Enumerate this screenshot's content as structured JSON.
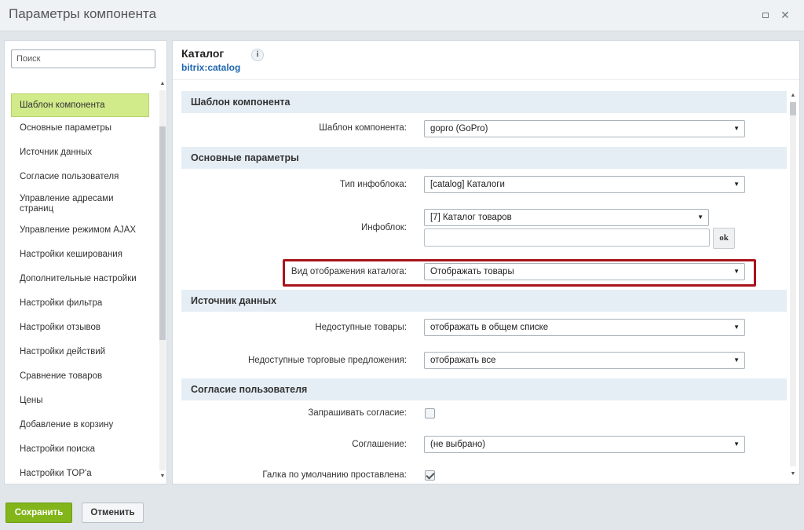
{
  "window": {
    "title": "Параметры компонента",
    "maximize_icon": "maximize-icon",
    "close_icon": "close-icon"
  },
  "sidebar": {
    "search_placeholder": "Поиск",
    "items": [
      {
        "label": "Шаблон компонента",
        "active": true
      },
      {
        "label": "Основные параметры"
      },
      {
        "label": "Источник данных"
      },
      {
        "label": "Согласие пользователя"
      },
      {
        "label": "Управление адресами страниц"
      },
      {
        "label": "Управление режимом AJAX"
      },
      {
        "label": "Настройки кеширования"
      },
      {
        "label": "Дополнительные настройки"
      },
      {
        "label": "Настройки фильтра"
      },
      {
        "label": "Настройки отзывов"
      },
      {
        "label": "Настройки действий"
      },
      {
        "label": "Сравнение товаров"
      },
      {
        "label": "Цены"
      },
      {
        "label": "Добавление в корзину"
      },
      {
        "label": "Настройки поиска"
      },
      {
        "label": "Настройки TOP'а"
      }
    ]
  },
  "component": {
    "title": "Каталог",
    "code": "bitrix:catalog",
    "info_icon": "info-icon",
    "info_glyph": "i"
  },
  "sections": {
    "template": {
      "title": "Шаблон компонента",
      "template_label": "Шаблон компонента:",
      "template_value": "gopro (GoPro)"
    },
    "main": {
      "title": "Основные параметры",
      "iblock_type_label": "Тип инфоблока:",
      "iblock_type_value": "[catalog] Каталоги",
      "iblock_label": "Инфоблок:",
      "iblock_value": "[7] Каталог товаров",
      "iblock_input_value": "",
      "ok_label": "ok",
      "view_mode_label": "Вид отображения каталога:",
      "view_mode_value": "Отображать товары"
    },
    "data_source": {
      "title": "Источник данных",
      "unavailable_label": "Недоступные товары:",
      "unavailable_value": "отображать в общем списке",
      "unavailable_offers_label": "Недоступные торговые предложения:",
      "unavailable_offers_value": "отображать все"
    },
    "consent": {
      "title": "Согласие пользователя",
      "ask_label": "Запрашивать согласие:",
      "ask_checked": false,
      "agreement_label": "Соглашение:",
      "agreement_value": "(не выбрано)",
      "default_check_label": "Галка по умолчанию проставлена:",
      "default_check_checked": true
    }
  },
  "footer": {
    "save_label": "Сохранить",
    "cancel_label": "Отменить"
  },
  "colors": {
    "highlight": "#a8141c",
    "save_button": "#82b51a",
    "active_item": "#d1ea8a",
    "section_bg": "#e6eef5",
    "link": "#2067b0"
  }
}
